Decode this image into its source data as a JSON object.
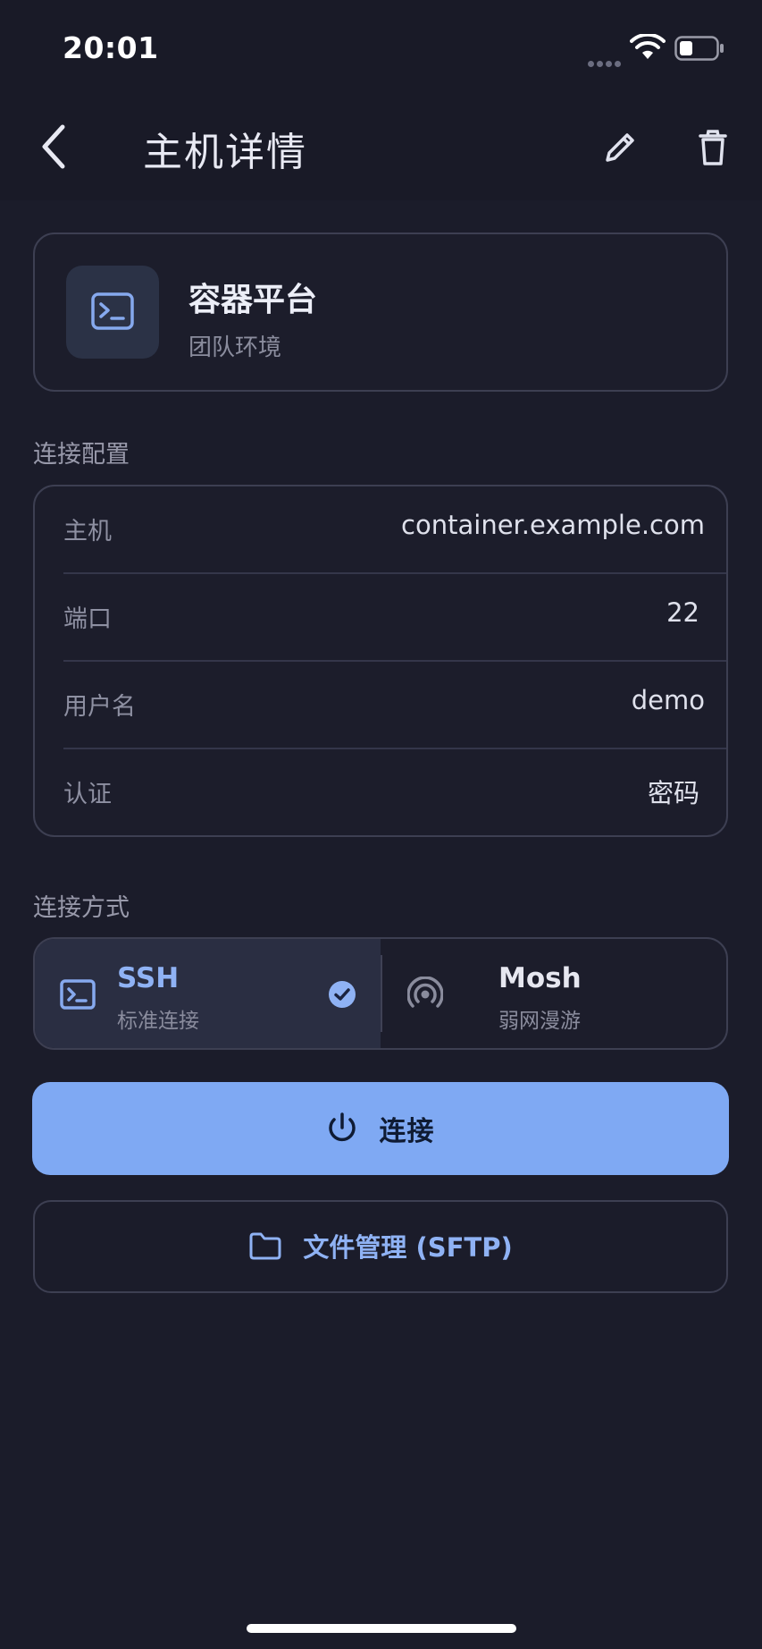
{
  "status_bar": {
    "time": "20:01"
  },
  "header": {
    "title": "主机详情",
    "back_icon": "chevron-left-icon",
    "edit_icon": "pencil-icon",
    "delete_icon": "trash-icon"
  },
  "host": {
    "name": "容器平台",
    "group": "团队环境",
    "icon": "terminal-icon"
  },
  "config": {
    "section_title": "连接配置",
    "rows": [
      {
        "key": "主机",
        "value": "container.example.com"
      },
      {
        "key": "端口",
        "value": "22"
      },
      {
        "key": "用户名",
        "value": "demo"
      },
      {
        "key": "认证",
        "value": "密码"
      }
    ]
  },
  "connection_mode": {
    "section_title": "连接方式",
    "options": [
      {
        "title": "SSH",
        "subtitle": "标准连接",
        "icon": "terminal-icon",
        "selected": true
      },
      {
        "title": "Mosh",
        "subtitle": "弱网漫游",
        "icon": "signal-icon",
        "selected": false
      }
    ]
  },
  "actions": {
    "connect_label": "连接",
    "sftp_label": "文件管理 (SFTP)"
  },
  "colors": {
    "background": "#1b1c2a",
    "accent": "#7fa9f3",
    "card_border": "#3d3f52",
    "selected_option": "#2a2e42"
  }
}
